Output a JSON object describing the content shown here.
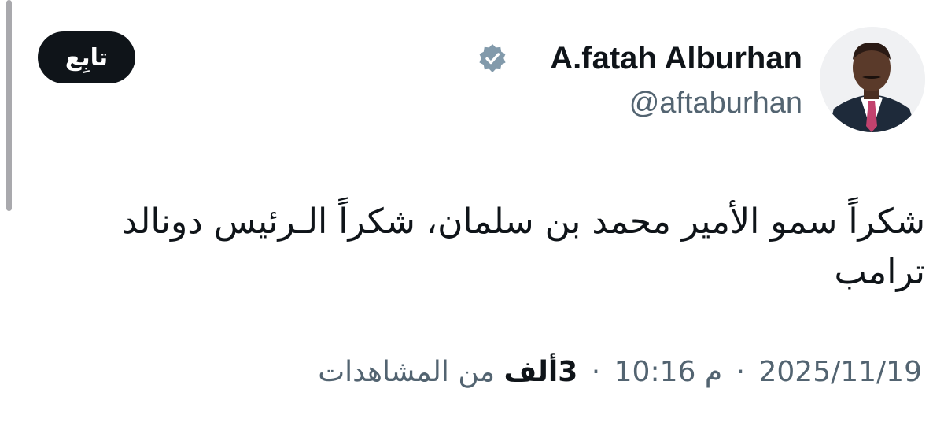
{
  "profile": {
    "display_name": "A.fatah Alburhan",
    "handle": "@aftaburhan",
    "verified": true,
    "badge_color": "#829aab"
  },
  "follow_button": {
    "label": "تابِع"
  },
  "tweet": {
    "text": "شكراً سمو الأمير محمد بن سلمان، شكراً الـرئيس دونالد ترامب"
  },
  "meta": {
    "date": "2025/11/19",
    "separator": "·",
    "time": "10:16 م",
    "views_count": "3ألف",
    "views_label": "من المشاهدات"
  },
  "colors": {
    "text_primary": "#0f1419",
    "text_secondary": "#536471",
    "button_bg": "#0f1419"
  }
}
